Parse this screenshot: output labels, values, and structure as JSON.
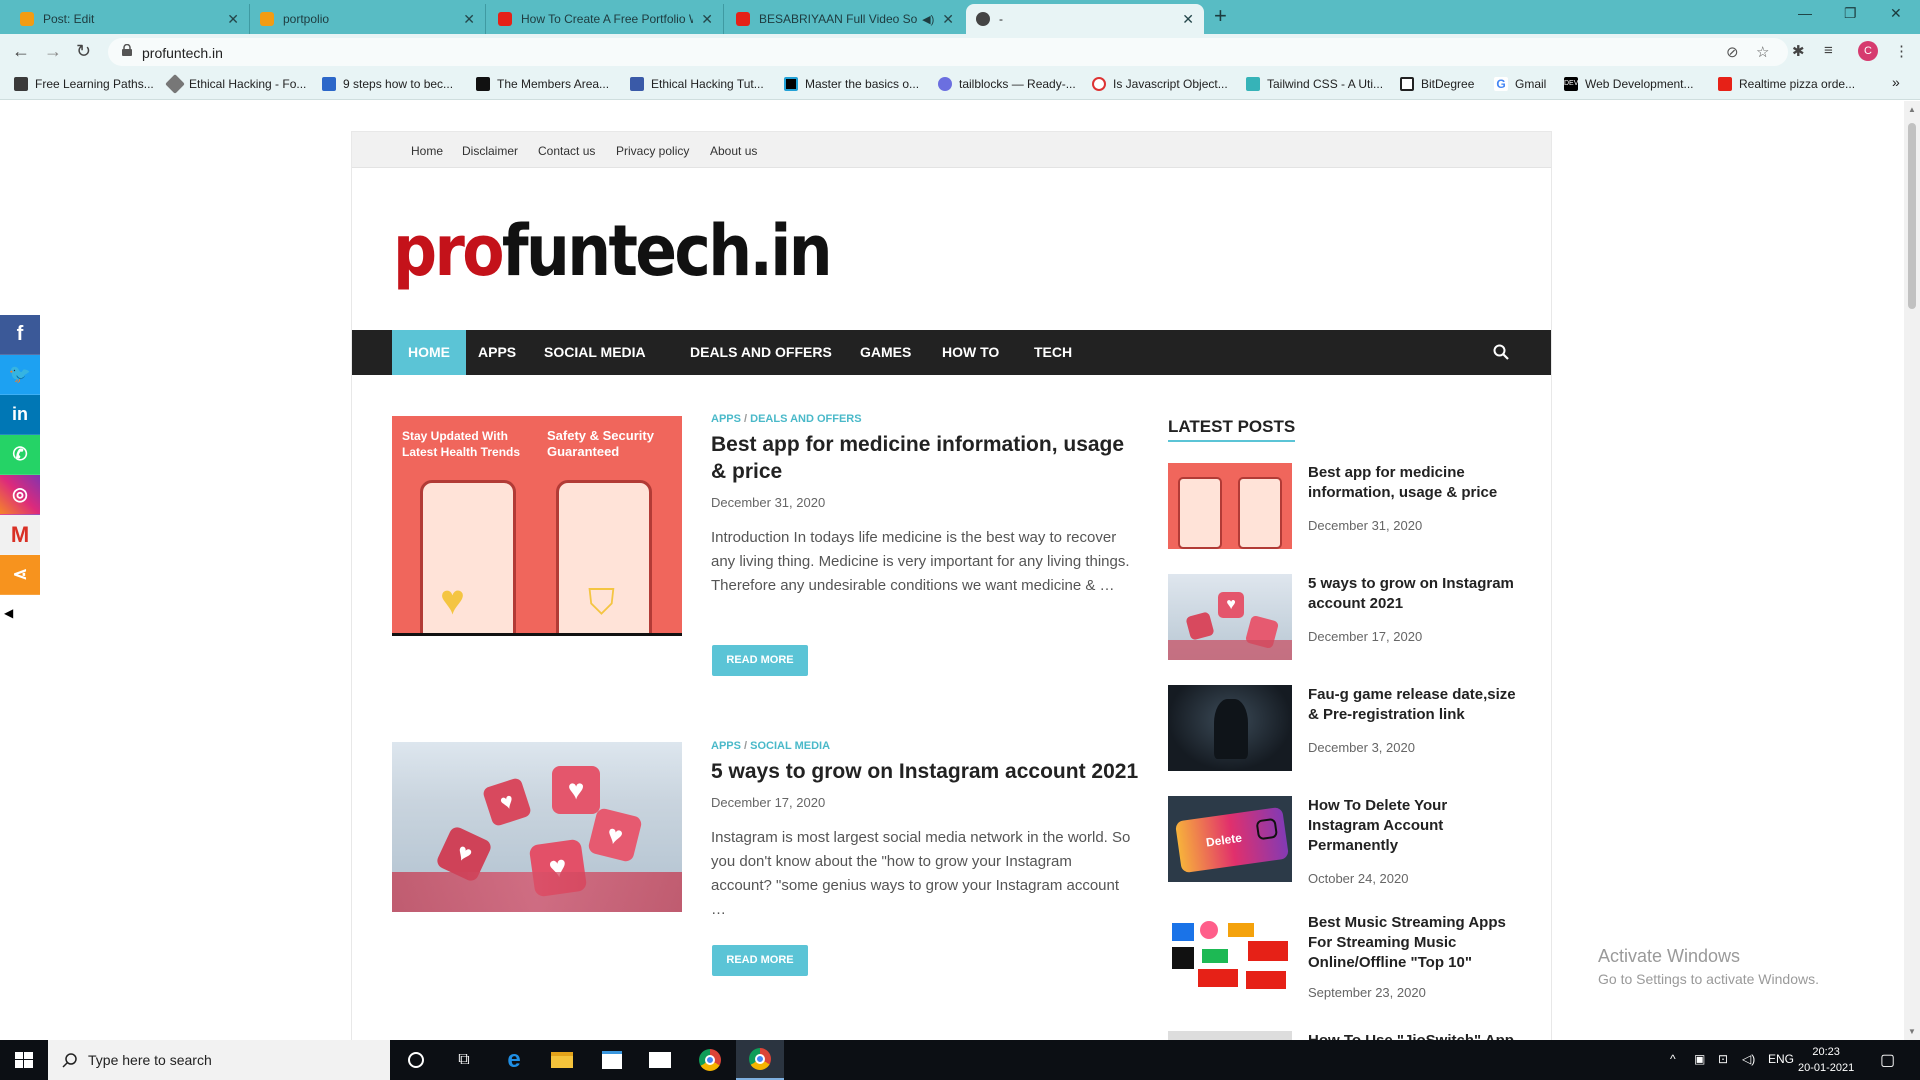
{
  "browser": {
    "tabs": [
      {
        "title": "Post: Edit",
        "color": "#f39c12"
      },
      {
        "title": "portpolio",
        "color": "#f39c12"
      },
      {
        "title": "How To Create A Free Portfolio W",
        "color": "#e62117"
      },
      {
        "title": "BESABRIYAAN Full Video So",
        "color": "#e62117"
      },
      {
        "title": "-",
        "color": "#444444"
      }
    ],
    "url": "profuntech.in",
    "avatar_letter": "C",
    "bookmarks": [
      "Free Learning Paths...",
      "Ethical Hacking - Fo...",
      "9 steps how to bec...",
      "The Members Area...",
      "Ethical Hacking Tut...",
      "Master the basics o...",
      "tailblocks — Ready-...",
      "Is Javascript Object...",
      "Tailwind CSS - A Uti...",
      "BitDegree",
      "Gmail",
      "Web Development...",
      "Realtime pizza orde..."
    ],
    "more_bookmarks": "»"
  },
  "social_share": [
    "facebook",
    "twitter",
    "linkedin",
    "whatsapp",
    "instagram",
    "gmail",
    "share"
  ],
  "site": {
    "top_menu": [
      "Home",
      "Disclaimer",
      "Contact us",
      "Privacy policy",
      "About us"
    ],
    "logo_red": "pro",
    "logo_black": "funtech.in",
    "main_menu": [
      "HOME",
      "APPS",
      "SOCIAL MEDIA",
      "DEALS AND OFFERS",
      "GAMES",
      "HOW TO",
      "TECH"
    ],
    "posts": [
      {
        "cat1": "APPS",
        "cat_sep": "/",
        "cat2": "DEALS AND OFFERS",
        "title": "Best app for medicine information, usage & price",
        "date": "December 31, 2020",
        "excerpt": "Introduction In todays life medicine is the best way to recover any living thing. Medicine is very important for any living things. Therefore any undesirable conditions we want medicine & …",
        "button": "READ MORE",
        "img_text_left": "Stay Updated With Latest Health Trends",
        "img_text_right": "Safety & Security Guaranteed"
      },
      {
        "cat1": "APPS",
        "cat_sep": "/",
        "cat2": "SOCIAL MEDIA",
        "title": "5 ways to grow on Instagram account 2021",
        "date": "December 17, 2020",
        "excerpt": "Instagram is most largest social media network in the world. So you don't know about the \"how to grow your Instagram account? \"some genius ways to grow your Instagram account …",
        "button": "READ MORE"
      }
    ],
    "sidebar": {
      "title": "LATEST POSTS",
      "items": [
        {
          "title": "Best app for medicine information, usage & price",
          "date": "December 31, 2020"
        },
        {
          "title": "5 ways to grow on Instagram account 2021",
          "date": "December 17, 2020"
        },
        {
          "title": "Fau-g game release date,size & Pre-registration link",
          "date": "December 3, 2020"
        },
        {
          "title": "How To Delete Your Instagram Account Permanently",
          "date": "October 24, 2020"
        },
        {
          "title": "Best Music Streaming Apps For Streaming Music Online/Offline \"Top 10\"",
          "date": "September 23, 2020"
        },
        {
          "title": "How To Use \"JioSwitch\" App",
          "date": ""
        }
      ]
    },
    "accent_color": "#5bc4d6"
  },
  "watermark": {
    "line1": "Activate Windows",
    "line2": "Go to Settings to activate Windows."
  },
  "taskbar": {
    "search_placeholder": "Type here to search",
    "lang": "ENG",
    "time": "20:23",
    "date": "20-01-2021"
  }
}
